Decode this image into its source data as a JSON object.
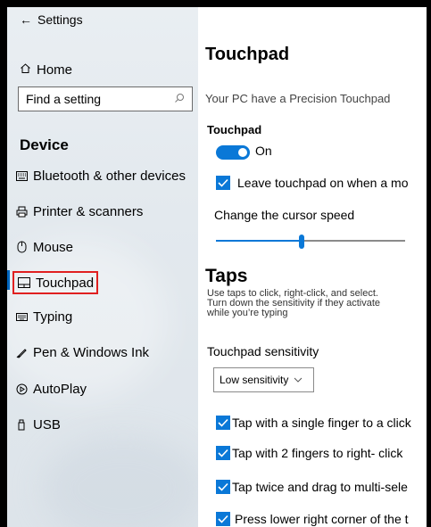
{
  "sidebar": {
    "back_label": "Settings",
    "home_label": "Home",
    "search_placeholder": "Find a setting",
    "section_title": "Device",
    "items": [
      {
        "label": "Bluetooth & other devices",
        "icon": "keyboard-icon"
      },
      {
        "label": "Printer & scanners",
        "icon": "printer-icon"
      },
      {
        "label": "Mouse",
        "icon": "mouse-icon"
      },
      {
        "label": "Touchpad",
        "icon": "touchpad-icon",
        "active": true
      },
      {
        "label": "Typing",
        "icon": "typing-icon"
      },
      {
        "label": "Pen & Windows Ink",
        "icon": "pen-icon"
      },
      {
        "label": "AutoPlay",
        "icon": "autoplay-icon"
      },
      {
        "label": "USB",
        "icon": "usb-icon"
      }
    ]
  },
  "main": {
    "title": "Touchpad",
    "precision_text": "Your PC have a Precision Touchpad",
    "touchpad_label": "Touchpad",
    "toggle_state": "On",
    "leave_on_text": "Leave touchpad on when a mo",
    "cursor_speed_label": "Change the cursor speed",
    "cursor_speed_value": 0.45,
    "taps_title": "Taps",
    "taps_desc_line1": "Use taps to click, right-click, and select.",
    "taps_desc_line2": "Turn down the sensitivity if they activate",
    "taps_desc_line3": "while you’re typing",
    "sensitivity_label": "Touchpad sensitivity",
    "sensitivity_value": "Low sensitivity",
    "tap_options": [
      "Tap with a single finger to a click",
      "Tap with 2 fingers to right- click",
      "Tap twice and drag to multi-sele",
      "Press lower right corner of the t"
    ]
  },
  "colors": {
    "accent": "#0a78d7",
    "active_highlight": "#e02020"
  }
}
